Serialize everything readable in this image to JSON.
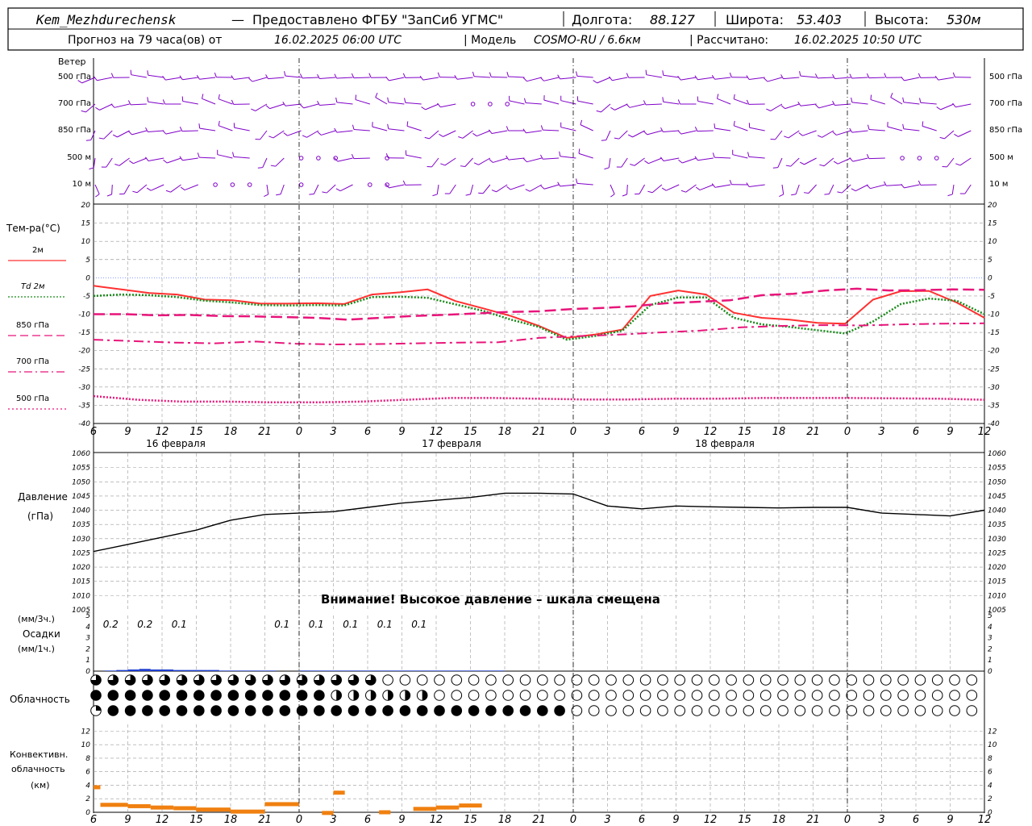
{
  "header": {
    "station": "Kem_Mezhdurechensk",
    "dash": "—",
    "provider": "Предоставлено ФГБУ \"ЗапСиб УГМС\"",
    "lon_label": "Долгота:",
    "lon_value": "88.127",
    "lat_label": "Широта:",
    "lat_value": "53.403",
    "height_label": "Высота:",
    "height_value": "530м",
    "forecast_prefix": "Прогноз на 79 часа(ов) от",
    "forecast_time": "16.02.2025 06:00 UTC",
    "model_prefix": "| Модель",
    "model_name": "COSMO-RU / 6.6км",
    "calc_prefix": "| Рассчитано:",
    "calc_time": "16.02.2025 10:50 UTC"
  },
  "wind_panel": {
    "title": "Ветер",
    "levels": [
      "500 гПа",
      "700 гПа",
      "850 гПа",
      "500 м",
      "10  м"
    ]
  },
  "temp_panel": {
    "title": "Тем-ра(°С)",
    "legend": [
      {
        "label": "2м",
        "color": "#ff3030",
        "style": "solid"
      },
      {
        "label": "Td  2м",
        "color": "#1a8a1a",
        "style": "dotted"
      },
      {
        "label": "850 гПа",
        "color": "#e8157a",
        "style": "dash"
      },
      {
        "label": "700 гПа",
        "color": "#e8157a",
        "style": "dashdot"
      },
      {
        "label": "500 гПа",
        "color": "#e8157a",
        "style": "dot"
      }
    ],
    "yticks": [
      "20",
      "15",
      "10",
      "5",
      "0",
      "-5",
      "-10",
      "-15",
      "-20",
      "-25",
      "-30",
      "-35",
      "-40"
    ]
  },
  "time_axis": {
    "hour_labels": [
      "6",
      "9",
      "12",
      "15",
      "18",
      "21",
      "0",
      "3",
      "6",
      "9",
      "12",
      "15",
      "18",
      "21",
      "0",
      "3",
      "6",
      "9",
      "12",
      "15",
      "18",
      "21",
      "0",
      "3",
      "6",
      "9",
      "12"
    ],
    "day_labels": [
      "16 февраля",
      "17 февраля",
      "18 февраля"
    ]
  },
  "pressure_panel": {
    "title": "Давление",
    "unit": "(гПа)",
    "yticks": [
      "1060",
      "1055",
      "1050",
      "1045",
      "1040",
      "1035",
      "1030",
      "1025",
      "1020",
      "1015",
      "1010",
      "1005"
    ],
    "warning": "Внимание! Высокое давление – шкала смещена"
  },
  "precip_panel": {
    "label_top": "(мм/3ч.)",
    "label_mid": "Осадки",
    "label_bot": "(мм/1ч.)",
    "yticks": [
      "5",
      "4",
      "3",
      "2",
      "1",
      "0"
    ],
    "sums": [
      "0.2",
      "0.2",
      "0.1",
      "0.1",
      "0.1",
      "0.1",
      "0.1",
      "0.1"
    ]
  },
  "cloud_panel": {
    "title": "Облачность"
  },
  "conv_panel": {
    "title_1": "Конвективн.",
    "title_2": "облачность",
    "title_3": "(км)",
    "yticks": [
      "12",
      "10",
      "8",
      "6",
      "4",
      "2",
      "0"
    ]
  },
  "colors": {
    "wind": "#8000c8",
    "t2m": "#ff3030",
    "td2m": "#1a8a1a",
    "upper": "#e8157a",
    "precip": "#1f3fd0",
    "conv": "#f08010",
    "grid": "#9a9a9a"
  },
  "chart_data": [
    {
      "type": "line",
      "panel": "temperature",
      "x_hours": [
        0,
        3,
        6,
        9,
        12,
        15,
        18,
        21,
        24,
        27,
        30,
        33,
        36,
        39,
        42,
        45,
        48,
        51,
        54,
        57,
        60,
        63,
        66,
        69,
        72,
        75,
        78
      ],
      "ylim": [
        -40,
        20
      ],
      "series": [
        {
          "name": "2м",
          "values": [
            -2.2,
            -3.2,
            -4.2,
            -4.6,
            -6,
            -6.2,
            -7.1,
            -7.1,
            -7,
            -7.2,
            -4.6,
            -4,
            -3.2,
            -6.4,
            -8.4,
            -10.5,
            -13.2,
            -16.5,
            -15.6,
            -14.2,
            -5,
            -3.5,
            -4.6,
            -9.6,
            -11,
            -11.5,
            -12.4,
            -12.6,
            -6,
            -3.7,
            -3.6,
            -6.8,
            -11
          ]
        },
        {
          "name": "Td  2м",
          "values": [
            -5,
            -4.6,
            -4.8,
            -5.3,
            -6.3,
            -6.8,
            -7.5,
            -7.6,
            -7.5,
            -7.6,
            -5.3,
            -5.2,
            -5.5,
            -7.3,
            -9.1,
            -11.5,
            -13.5,
            -17,
            -16,
            -14.5,
            -7.5,
            -5.4,
            -5.4,
            -11,
            -12.8,
            -13.5,
            -14.4,
            -15.3,
            -12,
            -7.2,
            -5.7,
            -6.3,
            -10
          ]
        },
        {
          "name": "850 гПа",
          "values": [
            -10,
            -10,
            -10.3,
            -10.2,
            -10.5,
            -10.6,
            -10.8,
            -11,
            -11.5,
            -11,
            -10.5,
            -10.2,
            -9.8,
            -9.4,
            -9.2,
            -8.6,
            -8.3,
            -7.8,
            -7,
            -6.6,
            -6.2,
            -4.8,
            -4.4,
            -3.5,
            -3,
            -3.5,
            -3.4,
            -3.2,
            -3.3
          ]
        },
        {
          "name": "700 гПа",
          "values": [
            -17,
            -17.4,
            -17.8,
            -18,
            -17.5,
            -18.1,
            -18.3,
            -18.2,
            -18,
            -17.8,
            -17.7,
            -16.5,
            -16,
            -15.6,
            -15,
            -14.5,
            -13.6,
            -13.2,
            -13,
            -13.1,
            -12.8,
            -12.6,
            -12.5
          ]
        },
        {
          "name": "500 гПа",
          "values": [
            -32.5,
            -33.5,
            -34,
            -34,
            -34.2,
            -34.2,
            -34,
            -33.5,
            -33,
            -33,
            -33.2,
            -33.4,
            -33.4,
            -33.2,
            -33.2,
            -33,
            -33,
            -33,
            -33.1,
            -33.2,
            -33.5
          ]
        }
      ]
    },
    {
      "type": "line",
      "panel": "pressure",
      "x_hours": [
        0,
        6,
        12,
        18,
        24,
        30,
        33,
        36,
        39,
        42,
        45,
        48,
        51,
        54,
        57,
        60,
        63,
        66,
        69,
        72,
        75,
        78
      ],
      "ylim": [
        1005,
        1060
      ],
      "series": [
        {
          "name": "",
          "values": [
            1025.5,
            1028,
            1030.5,
            1033,
            1036.5,
            1038.5,
            1039,
            1039.5,
            1041,
            1042.5,
            1043.5,
            1044.5,
            1046,
            1046,
            1045.7,
            1041.5,
            1040.5,
            1041.5,
            1041.2,
            1041,
            1040.8,
            1041,
            1041,
            1039,
            1038.5,
            1038,
            1040
          ]
        }
      ]
    },
    {
      "type": "bar",
      "panel": "precipitation_1h",
      "hours": [
        0,
        1,
        2,
        3,
        4,
        5,
        6,
        7,
        8,
        9,
        10,
        11,
        12,
        13,
        14,
        15,
        16,
        17,
        18,
        19,
        20,
        21,
        22,
        23,
        24,
        25,
        26,
        27,
        28,
        29,
        30,
        31,
        32,
        33,
        34,
        35,
        36,
        37,
        38,
        39,
        40,
        41,
        42,
        43,
        44,
        45,
        46,
        47,
        48,
        49,
        50,
        51,
        52,
        53,
        54,
        55,
        56,
        57,
        58,
        59,
        60,
        61,
        62,
        63,
        64,
        65,
        66,
        67,
        68,
        69,
        70,
        71,
        72,
        73,
        74,
        75,
        76,
        77,
        78
      ],
      "values": [
        0,
        0.05,
        0.1,
        0.15,
        0.2,
        0.15,
        0.15,
        0.1,
        0.1,
        0.1,
        0.1,
        0.05,
        0.05,
        0.05,
        0.05,
        0.05,
        0,
        0,
        0.05,
        0.05,
        0.05,
        0.05,
        0.05,
        0.05,
        0.05,
        0.05,
        0.05,
        0.05,
        0.05,
        0.05,
        0.05,
        0.05,
        0.05,
        0.05,
        0.05,
        0.05,
        0,
        0,
        0,
        0,
        0,
        0,
        0,
        0,
        0,
        0,
        0,
        0,
        0,
        0,
        0,
        0,
        0,
        0,
        0,
        0,
        0,
        0,
        0,
        0,
        0,
        0,
        0,
        0,
        0,
        0,
        0,
        0,
        0,
        0,
        0,
        0,
        0,
        0,
        0,
        0,
        0,
        0,
        0
      ],
      "ylim": [
        0,
        5
      ]
    },
    {
      "type": "bar",
      "panel": "convective_cloud",
      "segments_hours": [
        [
          0,
          0.6
        ],
        [
          0.6,
          3
        ],
        [
          3,
          5
        ],
        [
          5,
          7
        ],
        [
          7,
          9
        ],
        [
          9,
          12
        ],
        [
          12,
          15
        ],
        [
          15,
          18
        ],
        [
          20,
          21
        ],
        [
          21,
          22
        ],
        [
          25,
          26
        ],
        [
          28,
          30
        ],
        [
          30,
          32
        ],
        [
          32,
          34
        ]
      ],
      "tops_km": [
        4.0,
        1.4,
        1.2,
        1.0,
        0.9,
        0.7,
        0.4,
        1.5,
        0.2,
        3.2,
        0.3,
        0.8,
        1.0,
        1.3
      ],
      "ylim": [
        0,
        13
      ]
    }
  ]
}
